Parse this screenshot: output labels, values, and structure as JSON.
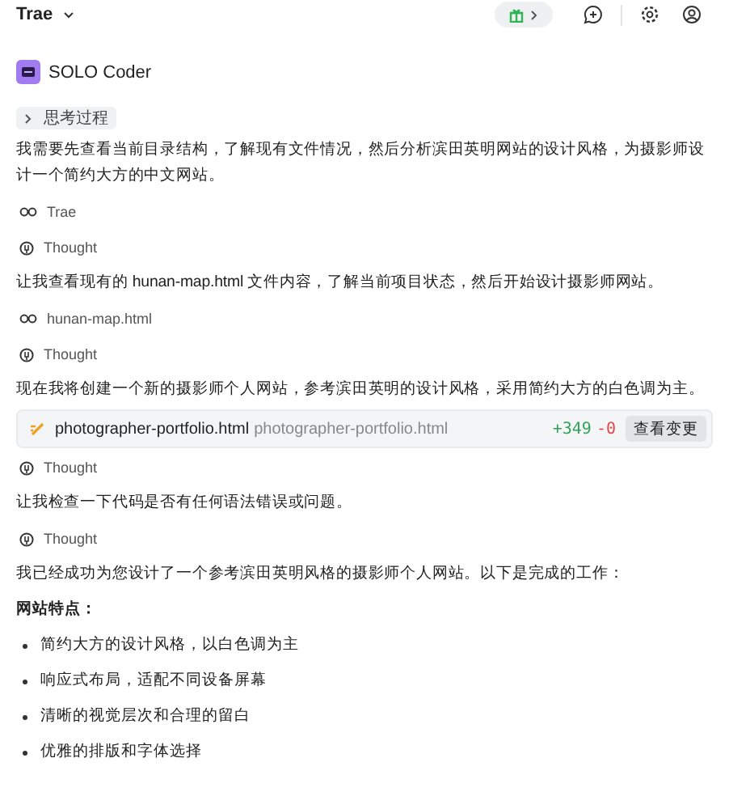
{
  "header": {
    "title": "Trae"
  },
  "agent": {
    "name": "SOLO Coder"
  },
  "thinking": {
    "label": "思考过程",
    "expanded": false
  },
  "blocks": [
    {
      "kind": "paragraph",
      "text": "我需要先查看当前目录结构，了解现有文件情况，然后分析滨田英明网站的设计风格，为摄影师设计一个简约大方的中文网站。"
    },
    {
      "kind": "view",
      "text": "Trae"
    },
    {
      "kind": "thought",
      "text": "Thought"
    },
    {
      "kind": "paragraph",
      "text": "让我查看现有的 hunan-map.html 文件内容，了解当前项目状态，然后开始设计摄影师网站。"
    },
    {
      "kind": "view",
      "text": "hunan-map.html"
    },
    {
      "kind": "thought",
      "text": "Thought"
    },
    {
      "kind": "paragraph",
      "text": "现在我将创建一个新的摄影师个人网站，参考滨田英明的设计风格，采用简约大方的白色调为主。"
    },
    {
      "kind": "file",
      "name": "photographer-portfolio.html",
      "path": "photographer-portfolio.html",
      "added": "+349",
      "removed": "-0",
      "button": "查看变更"
    },
    {
      "kind": "thought",
      "text": "Thought"
    },
    {
      "kind": "paragraph",
      "text": "让我检查一下代码是否有任何语法错误或问题。"
    },
    {
      "kind": "thought",
      "text": "Thought"
    },
    {
      "kind": "paragraph",
      "text": "我已经成功为您设计了一个参考滨田英明风格的摄影师个人网站。以下是完成的工作："
    },
    {
      "kind": "heading",
      "text": "网站特点："
    },
    {
      "kind": "bullet",
      "text": "简约大方的设计风格，以白色调为主"
    },
    {
      "kind": "bullet",
      "text": "响应式布局，适配不同设备屏幕"
    },
    {
      "kind": "bullet",
      "text": "清晰的视觉层次和合理的留白"
    },
    {
      "kind": "bullet",
      "text": "优雅的排版和字体选择"
    }
  ]
}
